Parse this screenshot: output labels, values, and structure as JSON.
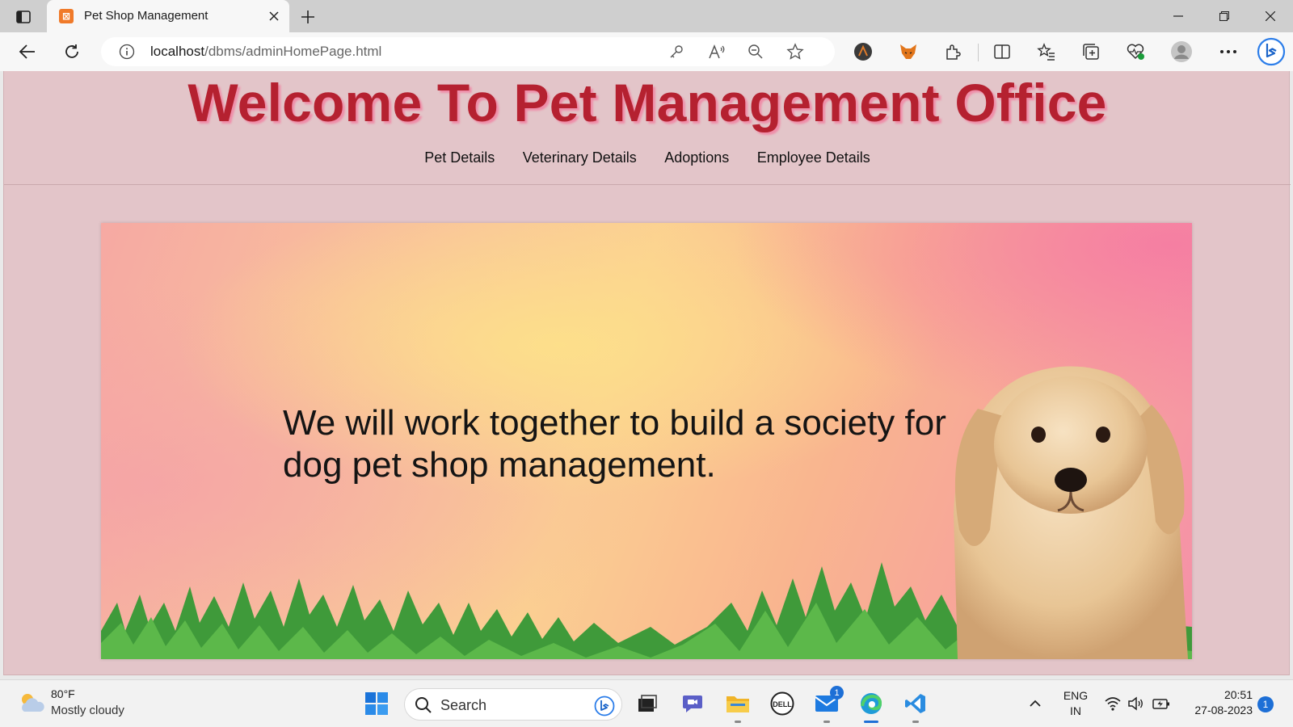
{
  "browser": {
    "tab_title": "Pet Shop Management",
    "url_host": "localhost",
    "url_path": "/dbms/adminHomePage.html"
  },
  "page": {
    "title": "Welcome To Pet Management Office",
    "menu": [
      "Pet Details",
      "Veterinary Details",
      "Adoptions",
      "Employee Details"
    ],
    "hero_text": "We will work together to build a society for dog pet shop management."
  },
  "taskbar": {
    "weather_temp": "80°F",
    "weather_desc": "Mostly cloudy",
    "search_label": "Search",
    "mail_badge": "1",
    "lang_line1": "ENG",
    "lang_line2": "IN",
    "time": "20:51",
    "date": "27-08-2023",
    "notification_count": "1"
  },
  "colors": {
    "title_red": "#b52130",
    "page_bg": "#e3c5c9",
    "accent_blue": "#1d6fd6"
  }
}
